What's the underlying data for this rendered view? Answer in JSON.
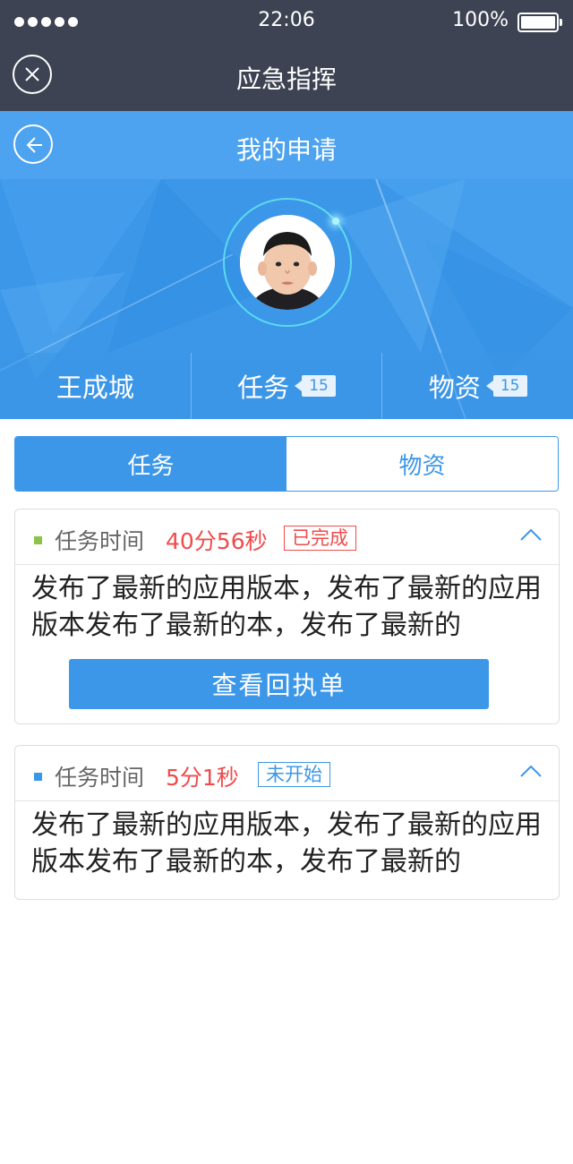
{
  "status_bar": {
    "time": "22:06",
    "battery": "100%"
  },
  "nav": {
    "title": "应急指挥",
    "close_icon": "close-circle-icon"
  },
  "sub_header": {
    "title": "我的申请",
    "back_icon": "back-arrow-icon"
  },
  "profile": {
    "name": "王成城",
    "stats": [
      {
        "label": "任务",
        "count": "15"
      },
      {
        "label": "物资",
        "count": "15"
      }
    ]
  },
  "tabs": [
    {
      "label": "任务",
      "active": true
    },
    {
      "label": "物资",
      "active": false
    }
  ],
  "cards": [
    {
      "label": "任务时间",
      "time": "40分56秒",
      "status": "已完成",
      "status_color": "#f04b4b",
      "dot_color": "#8bc34a",
      "body": "发布了最新的应用版本，发布了最新的应用版本发布了最新的本，发布了最新的",
      "button": "查看回执单"
    },
    {
      "label": "任务时间",
      "time": "5分1秒",
      "status": "未开始",
      "status_color": "#3c97e8",
      "dot_color": "#3c97e8",
      "body": "发布了最新的应用版本，发布了最新的应用版本发布了最新的本，发布了最新的"
    }
  ],
  "colors": {
    "nav_bg": "#3d4352",
    "accent": "#3c97e8",
    "alert": "#f04b4b"
  }
}
